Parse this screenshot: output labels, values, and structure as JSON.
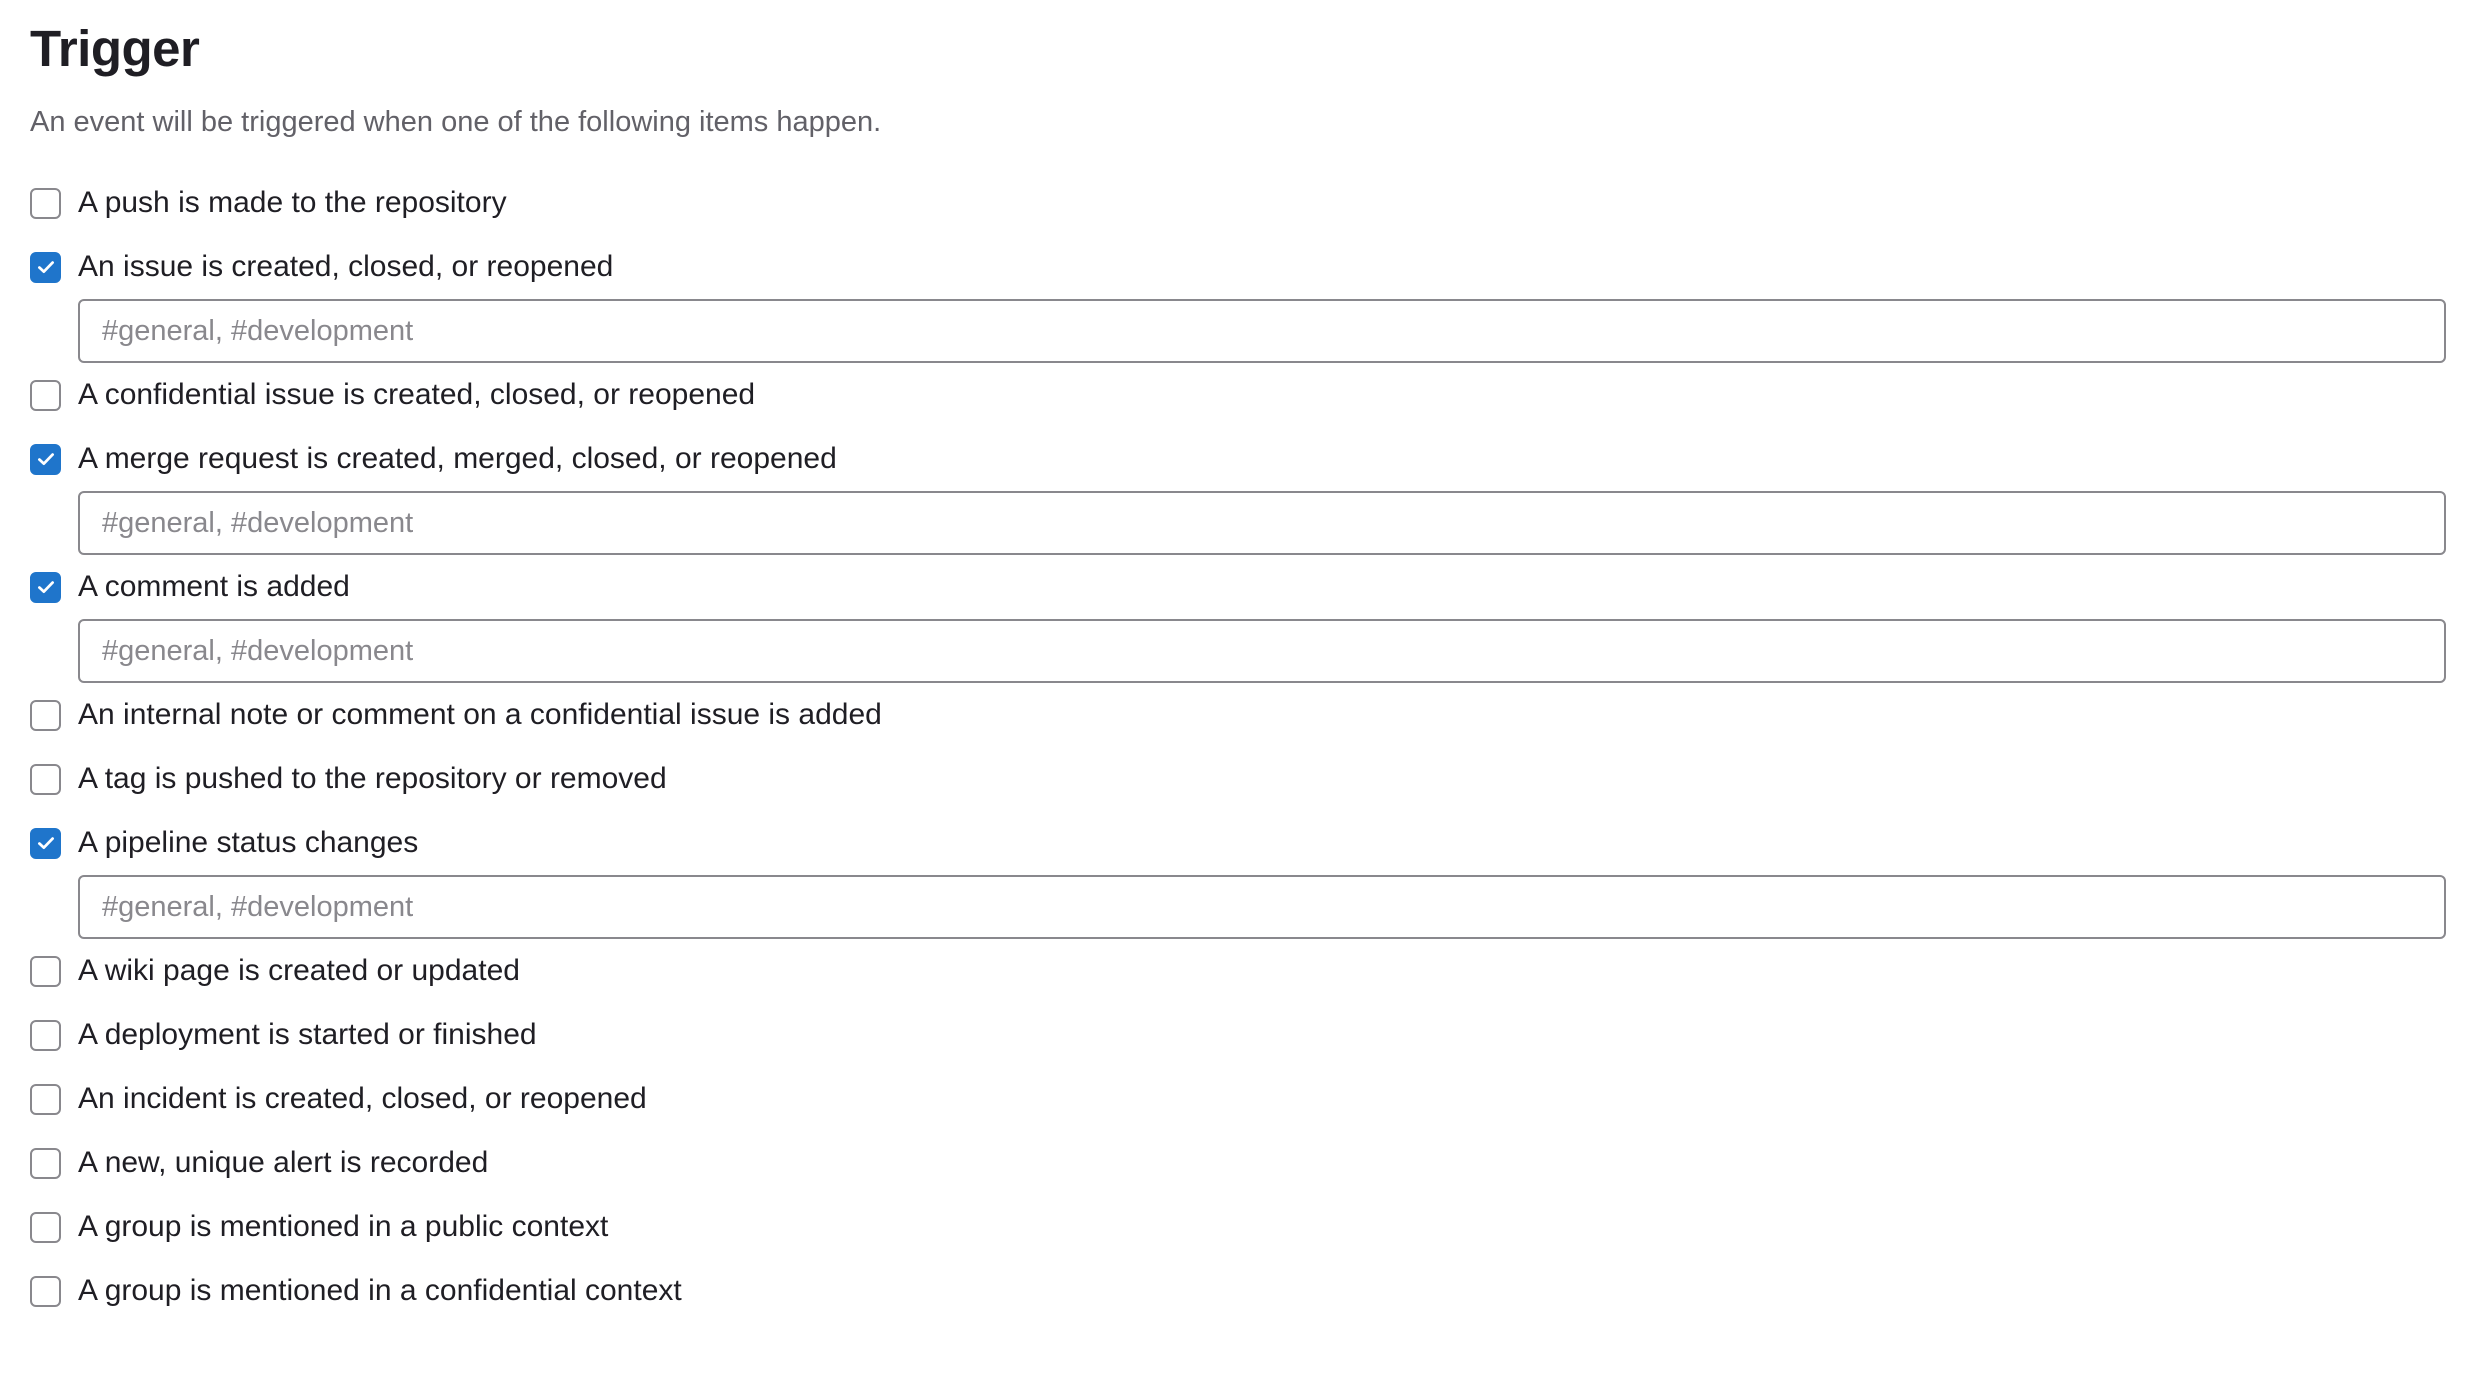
{
  "header": {
    "title": "Trigger",
    "subtitle": "An event will be triggered when one of the following items happen."
  },
  "colors": {
    "accent": "#1f75cb",
    "text": "#1f1e24",
    "muted": "#626168",
    "border": "#89888d"
  },
  "triggers": [
    {
      "key": "push",
      "label": "A push is made to the repository",
      "checked": false
    },
    {
      "key": "issue",
      "label": "An issue is created, closed, or reopened",
      "checked": true,
      "channel_value": "",
      "channel_placeholder": "#general, #development"
    },
    {
      "key": "confidential-issue",
      "label": "A confidential issue is created, closed, or reopened",
      "checked": false
    },
    {
      "key": "merge-request",
      "label": "A merge request is created, merged, closed, or reopened",
      "checked": true,
      "channel_value": "",
      "channel_placeholder": "#general, #development"
    },
    {
      "key": "comment",
      "label": "A comment is added",
      "checked": true,
      "channel_value": "",
      "channel_placeholder": "#general, #development"
    },
    {
      "key": "internal-note",
      "label": "An internal note or comment on a confidential issue is added",
      "checked": false
    },
    {
      "key": "tag-push",
      "label": "A tag is pushed to the repository or removed",
      "checked": false
    },
    {
      "key": "pipeline",
      "label": "A pipeline status changes",
      "checked": true,
      "channel_value": "",
      "channel_placeholder": "#general, #development"
    },
    {
      "key": "wiki-page",
      "label": "A wiki page is created or updated",
      "checked": false
    },
    {
      "key": "deployment",
      "label": "A deployment is started or finished",
      "checked": false
    },
    {
      "key": "incident",
      "label": "An incident is created, closed, or reopened",
      "checked": false
    },
    {
      "key": "alert",
      "label": "A new, unique alert is recorded",
      "checked": false
    },
    {
      "key": "group-mention",
      "label": "A group is mentioned in a public context",
      "checked": false
    },
    {
      "key": "group-confidential-mention",
      "label": "A group is mentioned in a confidential context",
      "checked": false
    }
  ]
}
